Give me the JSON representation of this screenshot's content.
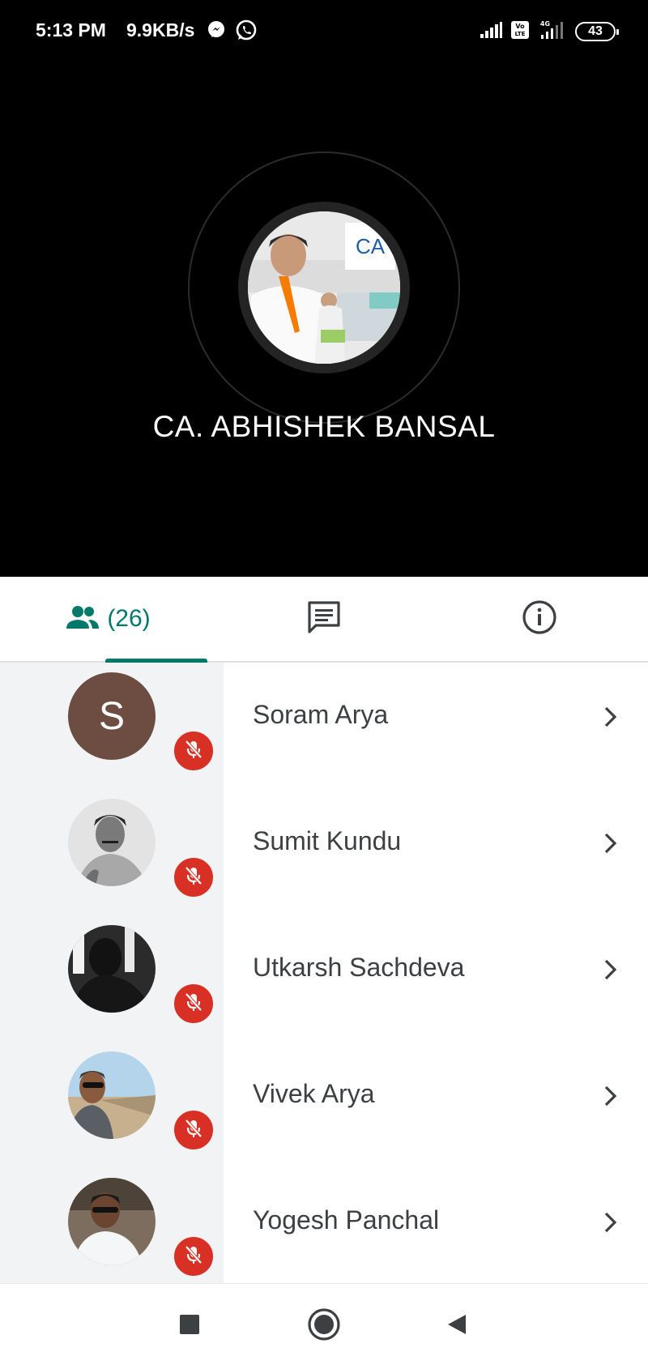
{
  "status_bar": {
    "time": "5:13 PM",
    "net_speed": "9.9KB/s",
    "volte": "Vo LTE",
    "network": "4G",
    "battery": "43"
  },
  "presenter": {
    "name": "CA. ABHISHEK BANSAL",
    "logo_text": "CA"
  },
  "tabs": {
    "participants_count": "(26)",
    "accent": "#00796b"
  },
  "participants": [
    {
      "name": "Soram Arya",
      "avatar": "letter",
      "initial": "S",
      "muted": true
    },
    {
      "name": "Sumit Kundu",
      "avatar": "photo",
      "muted": true
    },
    {
      "name": "Utkarsh Sachdeva",
      "avatar": "photo",
      "muted": true
    },
    {
      "name": "Vivek Arya",
      "avatar": "photo",
      "muted": true
    },
    {
      "name": "Yogesh Panchal",
      "avatar": "photo",
      "muted": true
    }
  ],
  "colors": {
    "mute_badge": "#d93025",
    "letter_avatar": "#6d4c41"
  },
  "icons": {
    "people": "people-icon",
    "chat": "chat-icon",
    "info": "info-icon",
    "mic_off": "mic-off-icon",
    "chevron": "chevron-right-icon",
    "nav_recents": "square-recents-icon",
    "nav_home": "circle-home-icon",
    "nav_back": "triangle-back-icon"
  }
}
